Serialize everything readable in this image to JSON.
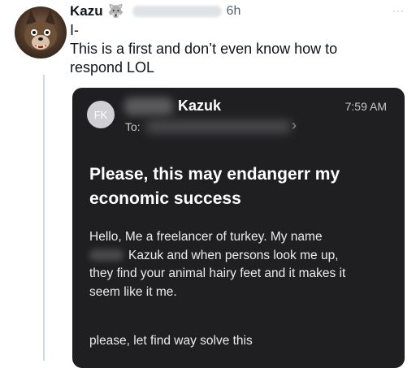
{
  "tweet": {
    "author_name": "Kazu",
    "author_badge_icon": "wolf-emoji-icon",
    "time": "6h",
    "more_icon": "···",
    "text_lines": [
      "I-",
      "This is a first and don’t even know how to",
      "respond LOL"
    ]
  },
  "email": {
    "avatar_initials": "FK",
    "sender": "Kazuk",
    "time": "7:59 AM",
    "to_label": "To:",
    "chevron": "›",
    "subject_lines": [
      "Please, this may endangerr my",
      "economic success"
    ],
    "body_lines": [
      "Hello, Me a freelancer of turkey. My name",
      "Kazuk and when persons look me up,",
      "they find your animal hairy feet and it makes it",
      "seem like it me."
    ],
    "closing": "please, let find way solve this"
  },
  "colors": {
    "card_bg": "#1f1f21",
    "thread_line": "#cfd9de",
    "text_primary": "#0f1419"
  }
}
